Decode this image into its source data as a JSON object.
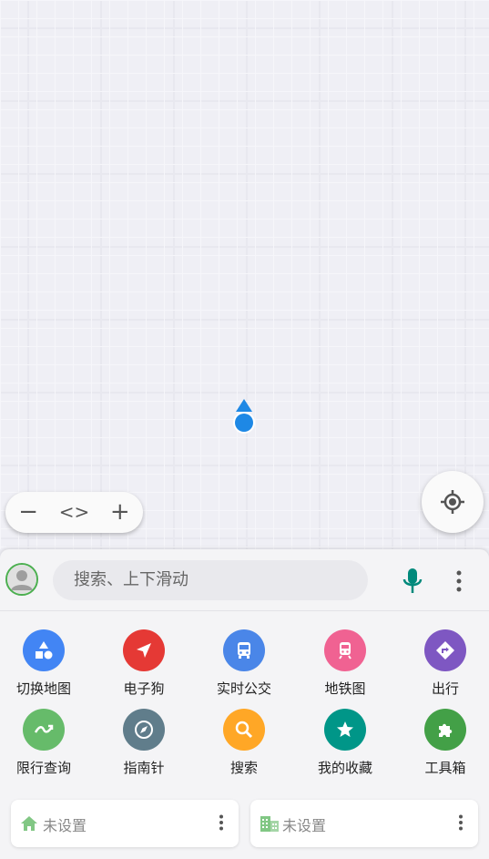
{
  "map": {
    "zoom_out": "−",
    "toggle": "<>",
    "zoom_in": "+"
  },
  "search": {
    "placeholder": "搜索、上下滑动"
  },
  "tools": [
    {
      "label": "切换地图",
      "icon": "shapes-icon",
      "color": "#4285f4"
    },
    {
      "label": "电子狗",
      "icon": "navigation-arrow-icon",
      "color": "#e53935"
    },
    {
      "label": "实时公交",
      "icon": "bus-icon",
      "color": "#4a86e8"
    },
    {
      "label": "地铁图",
      "icon": "train-icon",
      "color": "#f06292"
    },
    {
      "label": "出行",
      "icon": "directions-icon",
      "color": "#7e57c2"
    },
    {
      "label": "限行查询",
      "icon": "trend-icon",
      "color": "#66bb6a"
    },
    {
      "label": "指南针",
      "icon": "compass-icon",
      "color": "#607d8b"
    },
    {
      "label": "搜索",
      "icon": "search-icon",
      "color": "#ffa726"
    },
    {
      "label": "我的收藏",
      "icon": "star-icon",
      "color": "#009688"
    },
    {
      "label": "工具箱",
      "icon": "puzzle-icon",
      "color": "#43a047"
    }
  ],
  "shortcuts": {
    "home": {
      "label": "未设置",
      "icon": "home-icon",
      "color": "#81c784"
    },
    "work": {
      "label": "未设置",
      "icon": "building-icon",
      "color": "#81c784"
    }
  }
}
